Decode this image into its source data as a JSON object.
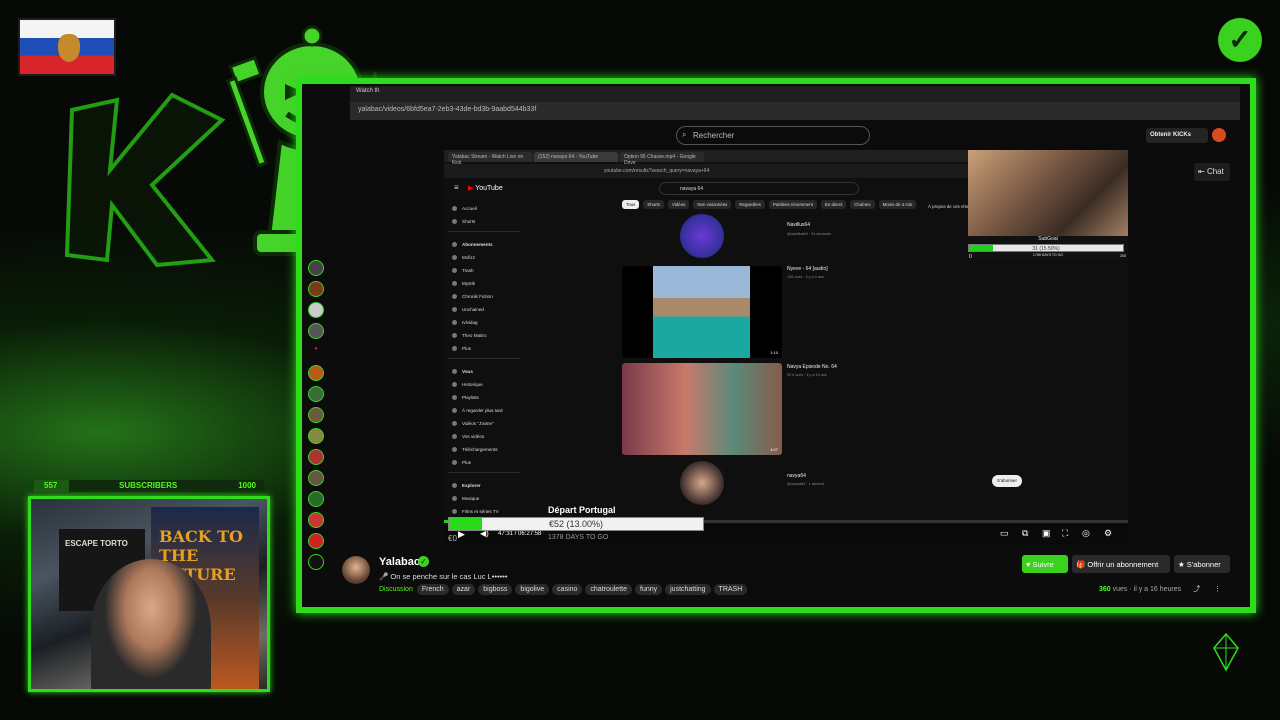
{
  "browser": {
    "tab_title": "Watch th",
    "url": "yalabac/videos/6bfd5ea7-2eb3-43de-bd3b-9aabd544b33f"
  },
  "kick": {
    "search_placeholder": "Rechercher",
    "obtenir_label": "Obtenir KICKs",
    "chat_label": "Chat"
  },
  "nested": {
    "tabs": [
      "Yalabac Stream - Watch Live on Kick",
      "(152) navaya 64 - YouTube",
      "Option 95 Chasse.mp4 - Google Drive"
    ],
    "url": "youtube.com/results?search_query=navaya+64",
    "search_query": "navaya 64",
    "chips": [
      "Tous",
      "Shorts",
      "Vidéos",
      "Non visionnées",
      "Regardées",
      "Publiées récemment",
      "En direct",
      "Chaînes",
      "Moins de 4 min",
      "À propos de ces résultats"
    ],
    "sidebar": {
      "main": [
        "Accueil",
        "Shorts"
      ],
      "subs_title": "Abonnements",
      "subs": [
        "Mcfizz",
        "Trash",
        "Mystik",
        "Chronik Fiction",
        "Unchained",
        "Ivlvidag",
        "Theo Maitro",
        "Plus"
      ],
      "vous_title": "Vous",
      "vous": [
        "Historique",
        "Playlists",
        "À regarder plus tard",
        "Vidéos \"J'aime\"",
        "Vos vidéos",
        "Téléchargements",
        "Plus"
      ],
      "explorer_title": "Explorer",
      "explorer": [
        "Musique",
        "Films et séries TV"
      ]
    },
    "results": [
      {
        "title": "Navillus64",
        "sub": "@navillus64 · 94 abonnés"
      },
      {
        "title": "Nyeve - 64 [audio]",
        "sub": "126 vues · il y a 4 ans",
        "duration": "1:10"
      },
      {
        "title": "Navya Episode No. 64",
        "sub": "92 k vues · il y a 14 ans",
        "duration": "4:07"
      },
      {
        "title": "navya64",
        "sub": "@navya64 · 1 abonné",
        "button": "S'abonner"
      }
    ]
  },
  "subgoal": {
    "title": "SubGoal",
    "text": "31 (15.50%)",
    "days": "1769 DAYS TO GO",
    "min": "0",
    "max": "200",
    "progress": 0.155
  },
  "player": {
    "time": "47:31 / 06:27:58",
    "progress": 0.12
  },
  "donation": {
    "title": "Départ Portugal",
    "label": "€52 (13.00%)",
    "days": "1378 DAYS TO GO",
    "progress": 0.13,
    "min_label": "€0"
  },
  "channel": {
    "name": "Yalabac",
    "title": "🎤 On se penche sur le cas Luc L••••••",
    "category": "Discussion",
    "tags": [
      "French",
      "azar",
      "bigboss",
      "bigolive",
      "casino",
      "chatroulette",
      "funny",
      "justchatting",
      "TRASH"
    ],
    "views_count": "360",
    "views_label": "vues",
    "time_ago": "il y a 16 heures"
  },
  "buttons": {
    "suivre": "♥ Suivre",
    "offrir": "🎁 Offrir un abonnement",
    "abonner": "★ S'abonner"
  },
  "subscribers": {
    "min": "557",
    "label": "SUBSCRIBERS",
    "max": "1000",
    "progress": 0.15
  },
  "cam": {
    "poster_text": "BACK TO THE FUTURE",
    "escape_text": "ESCAPE TORTO"
  },
  "colors": {
    "accent": "#53fc18",
    "frame": "#2fdc1b"
  }
}
